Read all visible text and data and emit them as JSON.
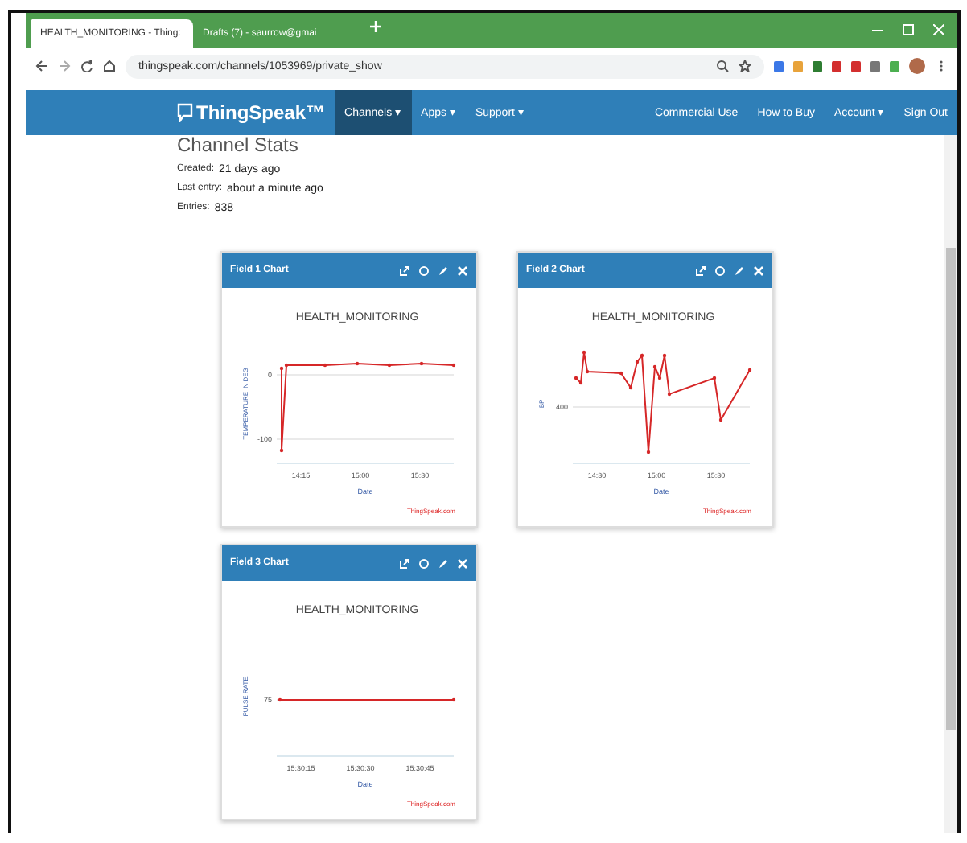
{
  "browser": {
    "tabs": [
      {
        "label": "HEALTH_MONITORING - Thing:",
        "selected": true
      },
      {
        "label": "Drafts (7) - saurrow@gmai",
        "selected": false
      }
    ],
    "url": "thingspeak.com/channels/1053969/private_show"
  },
  "navbar": {
    "logo": "ThingSpeak™",
    "left_items": [
      {
        "label": "Channels ▾",
        "selected": true
      },
      {
        "label": "Apps ▾",
        "selected": false
      },
      {
        "label": "Support ▾",
        "selected": false
      }
    ],
    "right_items": [
      "Commercial Use",
      "How to Buy",
      "Account ▾",
      "Sign Out"
    ]
  },
  "channel_stats": {
    "heading": "Channel Stats",
    "rows": [
      {
        "label": "Created:",
        "value": "21 days ago"
      },
      {
        "label": "Last entry:",
        "value": "about a minute ago"
      },
      {
        "label": "Entries:",
        "value": "838"
      }
    ]
  },
  "charts": [
    {
      "header": "Field 1 Chart",
      "kind": "spikes",
      "title": "HEALTH_MONITORING",
      "ylabel": "TEMPERATURE IN DEG",
      "yticks": [
        "0",
        "-100"
      ],
      "xticks": [
        "14:15",
        "15:00",
        "15:30"
      ],
      "xlabel": "Date",
      "credit": "ThingSpeak.com"
    },
    {
      "header": "Field 2 Chart",
      "kind": "zigzag",
      "title": "HEALTH_MONITORING",
      "ylabel": "BP",
      "yticks": [
        "400"
      ],
      "xticks": [
        "14:30",
        "15:00",
        "15:30"
      ],
      "xlabel": "Date",
      "credit": "ThingSpeak.com"
    },
    {
      "header": "Field 3 Chart",
      "kind": "flat",
      "title": "HEALTH_MONITORING",
      "ylabel": "PULSE RATE",
      "yticks": [
        "75"
      ],
      "xticks": [
        "15:30:15",
        "15:30:30",
        "15:30:45"
      ],
      "xlabel": "Date",
      "credit": "ThingSpeak.com"
    }
  ]
}
